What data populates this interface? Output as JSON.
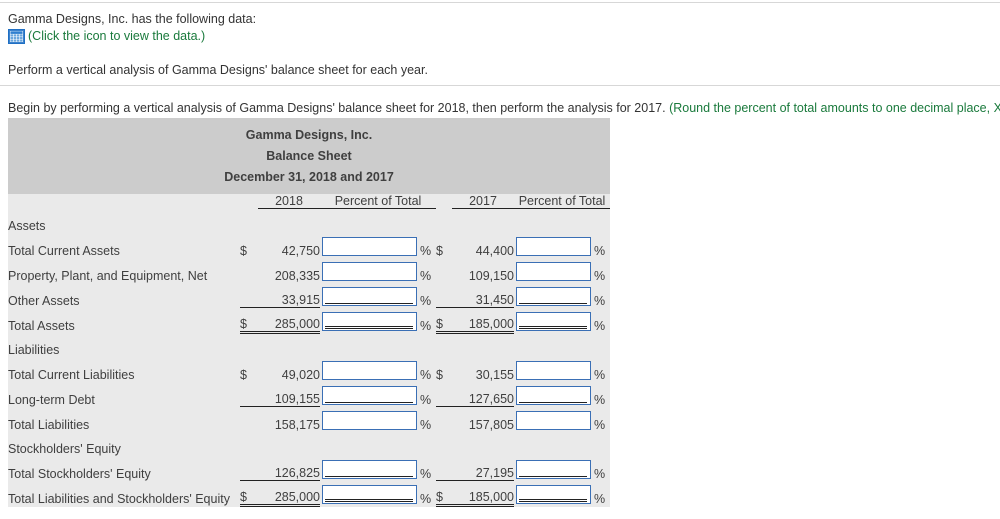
{
  "prompts": {
    "intro": "Gamma Designs, Inc. has the following data:",
    "icon_link": "(Click the icon to view the data.)",
    "icon_name": "spreadsheet-icon",
    "perform": "Perform a vertical analysis of Gamma Designs' balance sheet for each year.",
    "begin_main": "Begin by performing a vertical analysis of Gamma Designs' balance sheet for 2018, then perform the analysis for 2017. ",
    "begin_hint": "(Round the percent of total amounts to one decimal place, X.X%.)"
  },
  "colors": {
    "hint_green": "#1a7a3c",
    "header_band": "#cccccc",
    "table_body": "#eaeaea",
    "input_border": "#3a6fb5",
    "text": "#3f3f3f"
  },
  "statement": {
    "company": "Gamma Designs, Inc.",
    "title": "Balance Sheet",
    "date": "December 31, 2018 and 2017",
    "columns": {
      "label": "",
      "year1": "2018",
      "pct1": "Percent of Total",
      "year2": "2017",
      "pct2": "Percent of Total"
    },
    "percent_symbol": "%",
    "dollar_symbol": "$",
    "sections": [
      {
        "heading": "Assets",
        "rows": [
          {
            "label": "Total Current Assets",
            "dollar1": "$",
            "amount1": "42,750",
            "input1": "",
            "dollar2": "$",
            "amount2": "44,400",
            "input2": "",
            "rule": "none",
            "bold": false
          },
          {
            "label": "Property, Plant, and Equipment, Net",
            "dollar1": "",
            "amount1": "208,335",
            "input1": "",
            "dollar2": "",
            "amount2": "109,150",
            "input2": "",
            "rule": "none",
            "bold": false
          },
          {
            "label": "Other Assets",
            "dollar1": "",
            "amount1": "33,915",
            "input1": "",
            "dollar2": "",
            "amount2": "31,450",
            "input2": "",
            "rule": "single",
            "bold": false
          },
          {
            "label": "Total Assets",
            "dollar1": "$",
            "amount1": "285,000",
            "input1": "",
            "dollar2": "$",
            "amount2": "185,000",
            "input2": "",
            "rule": "double",
            "bold": true
          }
        ]
      },
      {
        "heading": "Liabilities",
        "rows": [
          {
            "label": "Total Current Liabilities",
            "dollar1": "$",
            "amount1": "49,020",
            "input1": "",
            "dollar2": "$",
            "amount2": "30,155",
            "input2": "",
            "rule": "none",
            "bold": false
          },
          {
            "label": "Long-term Debt",
            "dollar1": "",
            "amount1": "109,155",
            "input1": "",
            "dollar2": "",
            "amount2": "127,650",
            "input2": "",
            "rule": "single",
            "bold": false
          },
          {
            "label": "Total Liabilities",
            "dollar1": "",
            "amount1": "158,175",
            "input1": "",
            "dollar2": "",
            "amount2": "157,805",
            "input2": "",
            "rule": "none",
            "bold": false
          }
        ]
      },
      {
        "heading": "Stockholders' Equity",
        "rows": [
          {
            "label": "Total Stockholders' Equity",
            "dollar1": "",
            "amount1": "126,825",
            "input1": "",
            "dollar2": "",
            "amount2": "27,195",
            "input2": "",
            "rule": "single",
            "bold": false
          },
          {
            "label": "Total Liabilities and Stockholders' Equity",
            "dollar1": "$",
            "amount1": "285,000",
            "input1": "",
            "dollar2": "$",
            "amount2": "185,000",
            "input2": "",
            "rule": "double",
            "bold": true
          }
        ]
      }
    ]
  }
}
